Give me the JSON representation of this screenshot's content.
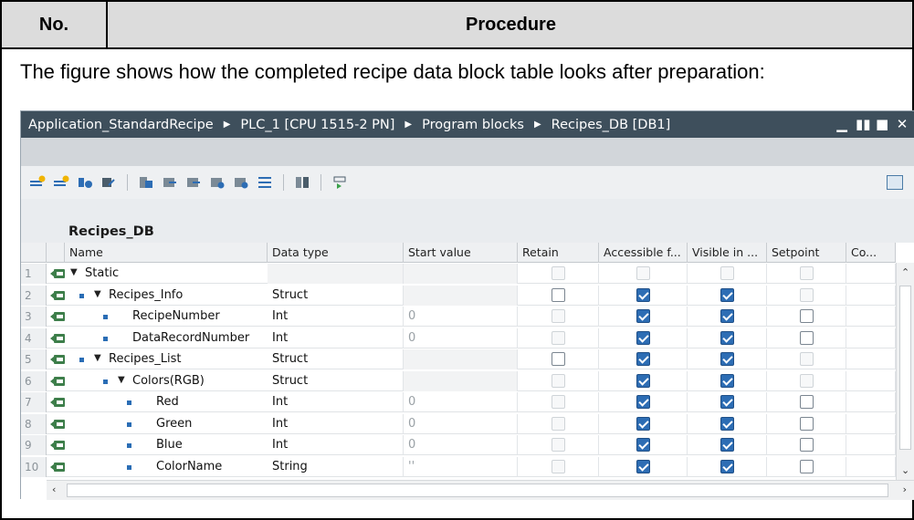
{
  "doc": {
    "col_no": "No.",
    "col_procedure": "Procedure",
    "text": "The figure shows how the completed recipe data block table looks after preparation:"
  },
  "window": {
    "breadcrumbs": [
      "Application_StandardRecipe",
      "PLC_1 [CPU 1515-2 PN]",
      "Program blocks",
      "Recipes_DB [DB1]"
    ],
    "db_title": "Recipes_DB"
  },
  "grid": {
    "headers": [
      "Name",
      "Data type",
      "Start value",
      "Retain",
      "Accessible f...",
      "Visible in ...",
      "Setpoint",
      "Co..."
    ],
    "rows": [
      {
        "num": "1",
        "name": "Static",
        "expanded": true,
        "bullet": false,
        "level": 0,
        "type": "",
        "start": "",
        "retain": "dis",
        "access": "dis",
        "visible": "dis",
        "setpoint": "dis"
      },
      {
        "num": "2",
        "name": "Recipes_Info",
        "expanded": true,
        "bullet": true,
        "level": 1,
        "type": "Struct",
        "start": "",
        "retain": "off",
        "access": "on",
        "visible": "on",
        "setpoint": "dis"
      },
      {
        "num": "3",
        "name": "RecipeNumber",
        "expanded": false,
        "bullet": true,
        "level": 2,
        "type": "Int",
        "start": "0",
        "retain": "dis",
        "access": "on",
        "visible": "on",
        "setpoint": "off"
      },
      {
        "num": "4",
        "name": "DataRecordNumber",
        "expanded": false,
        "bullet": true,
        "level": 2,
        "type": "Int",
        "start": "0",
        "retain": "dis",
        "access": "on",
        "visible": "on",
        "setpoint": "off"
      },
      {
        "num": "5",
        "name": "Recipes_List",
        "expanded": true,
        "bullet": true,
        "level": 1,
        "type": "Struct",
        "start": "",
        "retain": "off",
        "access": "on",
        "visible": "on",
        "setpoint": "dis"
      },
      {
        "num": "6",
        "name": "Colors(RGB)",
        "expanded": true,
        "bullet": true,
        "level": 2,
        "type": "Struct",
        "start": "",
        "retain": "dis",
        "access": "on",
        "visible": "on",
        "setpoint": "dis"
      },
      {
        "num": "7",
        "name": "Red",
        "expanded": false,
        "bullet": true,
        "level": 3,
        "type": "Int",
        "start": "0",
        "retain": "dis",
        "access": "on",
        "visible": "on",
        "setpoint": "off"
      },
      {
        "num": "8",
        "name": "Green",
        "expanded": false,
        "bullet": true,
        "level": 3,
        "type": "Int",
        "start": "0",
        "retain": "dis",
        "access": "on",
        "visible": "on",
        "setpoint": "off"
      },
      {
        "num": "9",
        "name": "Blue",
        "expanded": false,
        "bullet": true,
        "level": 3,
        "type": "Int",
        "start": "0",
        "retain": "dis",
        "access": "on",
        "visible": "on",
        "setpoint": "off"
      },
      {
        "num": "10",
        "name": "ColorName",
        "expanded": false,
        "bullet": true,
        "level": 3,
        "type": "String",
        "start": "''",
        "retain": "dis",
        "access": "on",
        "visible": "on",
        "setpoint": "off"
      }
    ]
  },
  "colors": {
    "titlebar": "#3e4f5c",
    "checkbox_on": "#2d6db4",
    "bullet": "#2a6db5"
  }
}
